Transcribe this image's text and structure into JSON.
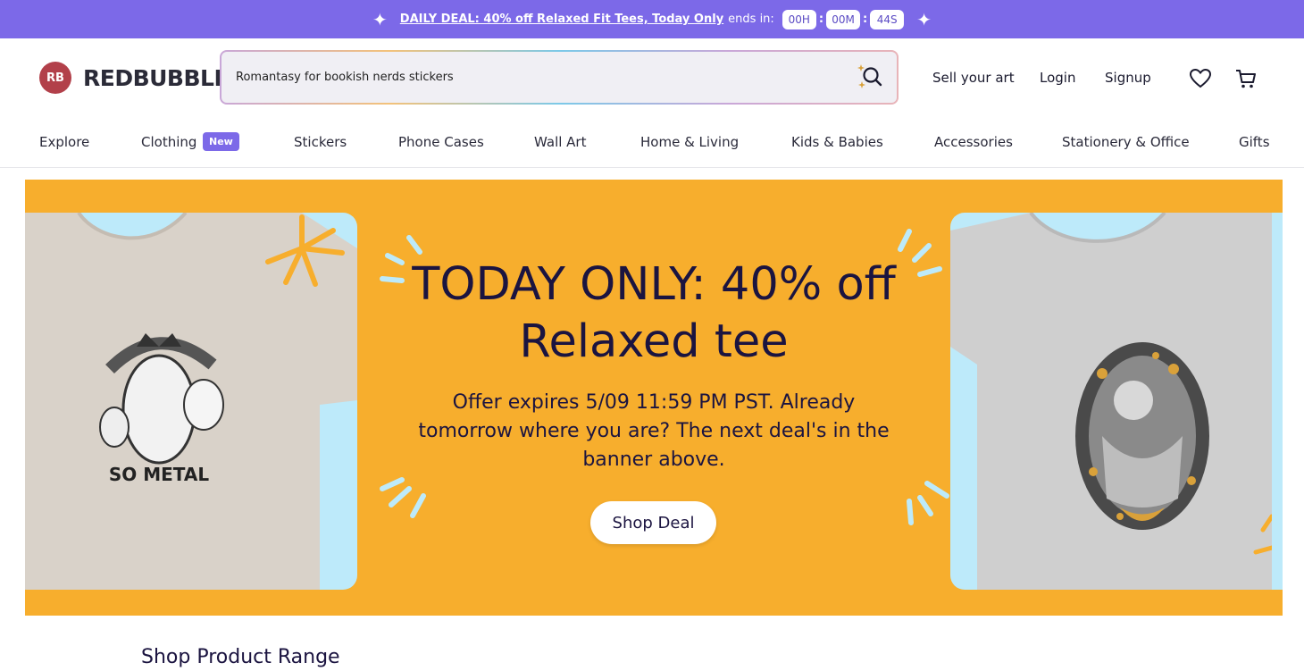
{
  "promo": {
    "deal_text": "DAILY DEAL: 40% off Relaxed Fit Tees, Today Only",
    "ends_text": "ends in:",
    "hours": "00H",
    "minutes": "00M",
    "seconds": "44S",
    "bg_color": "#7c69e8"
  },
  "header": {
    "logo_mark": "RB",
    "logo_text": "REDBUBBLE",
    "search_value": "Romantasy for bookish nerds stickers",
    "sell_label": "Sell your art",
    "login_label": "Login",
    "signup_label": "Signup",
    "icons": [
      "search-icon",
      "heart-icon",
      "cart-icon"
    ]
  },
  "nav": {
    "items": [
      "Explore",
      "Clothing",
      "Stickers",
      "Phone Cases",
      "Wall Art",
      "Home & Living",
      "Kids & Babies",
      "Accessories",
      "Stationery & Office",
      "Gifts"
    ],
    "new_badge": "New"
  },
  "hero": {
    "title": "TODAY ONLY: 40% off Relaxed tee",
    "subtitle": "Offer expires 5/09 11:59 PM PST. Already tomorrow where you are? The next deal's in the banner above.",
    "cta": "Shop Deal",
    "left_shirt_text": "SO METAL",
    "bg_color": "#f7ae2d",
    "panel_color": "#bdeafa"
  },
  "section": {
    "title": "Shop Product Range"
  }
}
